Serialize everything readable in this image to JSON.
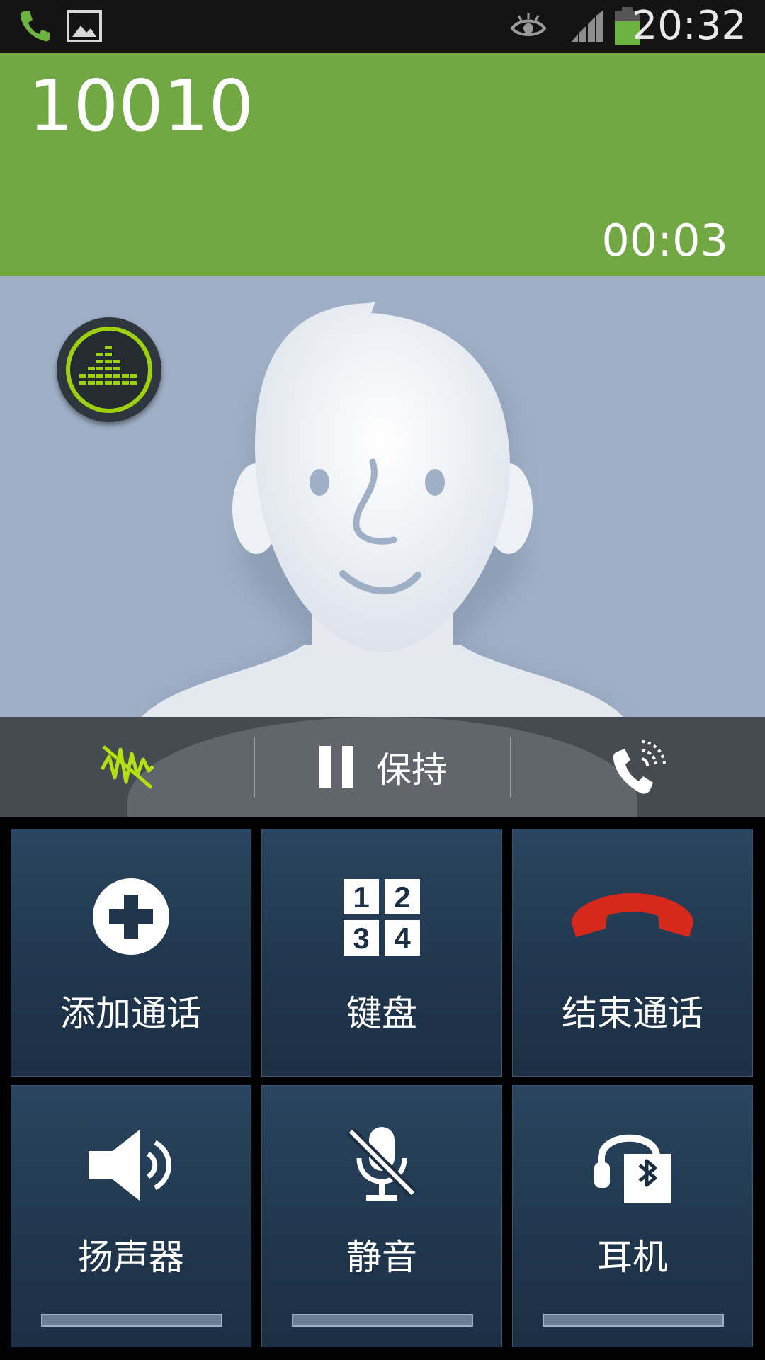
{
  "status_bar": {
    "time": "20:32",
    "icons": [
      "phone-call-icon",
      "gallery-icon",
      "smart-stay-eye-icon",
      "signal-icon",
      "battery-icon"
    ],
    "accent_green": "#6cb33f"
  },
  "call": {
    "number": "10010",
    "duration": "00:03",
    "header_color": "#72a844"
  },
  "action_bar": {
    "hold_label": "保持",
    "left_icon": "noise-reduction-icon",
    "right_icon": "call-wave-icon"
  },
  "controls": [
    {
      "label": "添加通话",
      "icon": "add-call-icon"
    },
    {
      "label": "键盘",
      "icon": "keypad-icon"
    },
    {
      "label": "结束通话",
      "icon": "end-call-icon"
    },
    {
      "label": "扬声器",
      "icon": "speaker-icon"
    },
    {
      "label": "静音",
      "icon": "mute-icon"
    },
    {
      "label": "耳机",
      "icon": "bluetooth-headset-icon"
    }
  ],
  "keypad_digits": [
    "1",
    "2",
    "3",
    "4"
  ],
  "end_call_color": "#d52a1b"
}
